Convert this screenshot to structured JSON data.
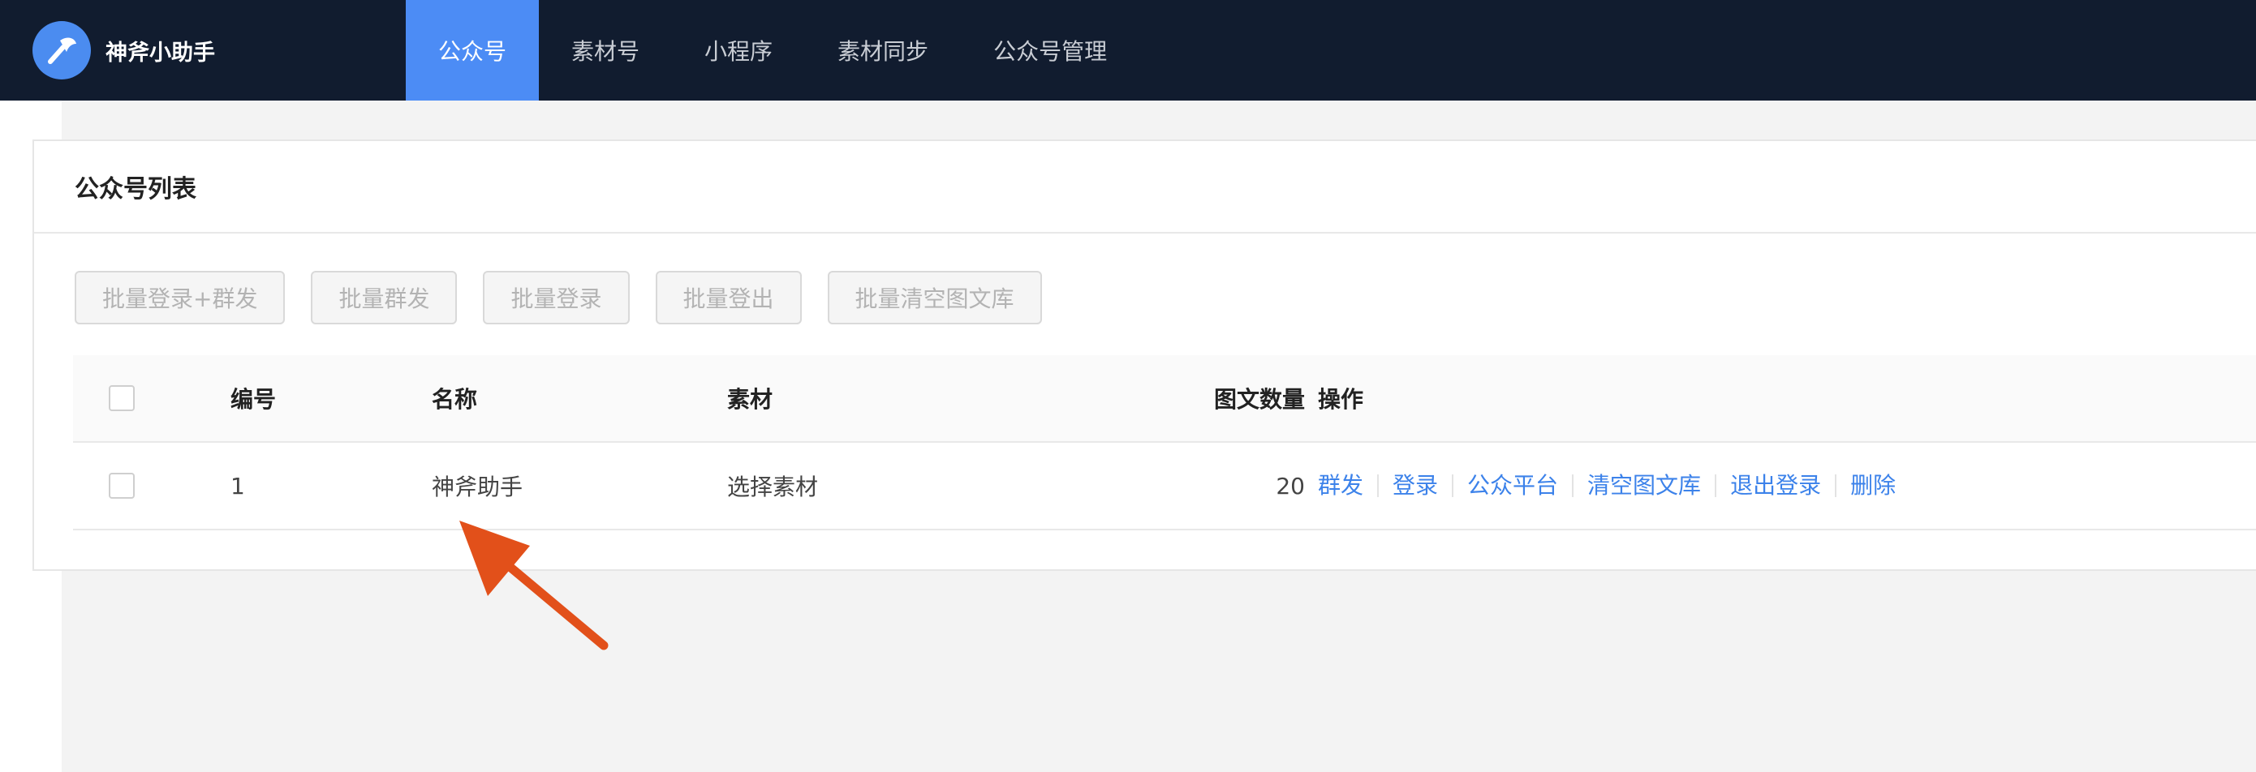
{
  "app": {
    "name": "神斧小助手",
    "logo_icon": "axe-icon"
  },
  "nav": {
    "items": [
      {
        "label": "公众号",
        "active": true
      },
      {
        "label": "素材号",
        "active": false
      },
      {
        "label": "小程序",
        "active": false
      },
      {
        "label": "素材同步",
        "active": false
      },
      {
        "label": "公众号管理",
        "active": false
      }
    ]
  },
  "card": {
    "title": "公众号列表"
  },
  "toolbar": {
    "buttons": [
      {
        "label": "批量登录+群发",
        "disabled": true
      },
      {
        "label": "批量群发",
        "disabled": true
      },
      {
        "label": "批量登录",
        "disabled": true
      },
      {
        "label": "批量登出",
        "disabled": true
      },
      {
        "label": "批量清空图文库",
        "disabled": true
      }
    ]
  },
  "table": {
    "columns": [
      "编号",
      "名称",
      "素材",
      "图文数量",
      "操作"
    ],
    "rows": [
      {
        "id": "1",
        "name": "神斧助手",
        "material": "选择素材",
        "count": "20",
        "checked": false,
        "actions": [
          "群发",
          "登录",
          "公众平台",
          "清空图文库",
          "退出登录",
          "删除"
        ]
      }
    ]
  },
  "colors": {
    "nav_bg": "#111c2f",
    "nav_active": "#4c8cf5",
    "link": "#3c82ea",
    "annotation_arrow": "#e2501a"
  }
}
